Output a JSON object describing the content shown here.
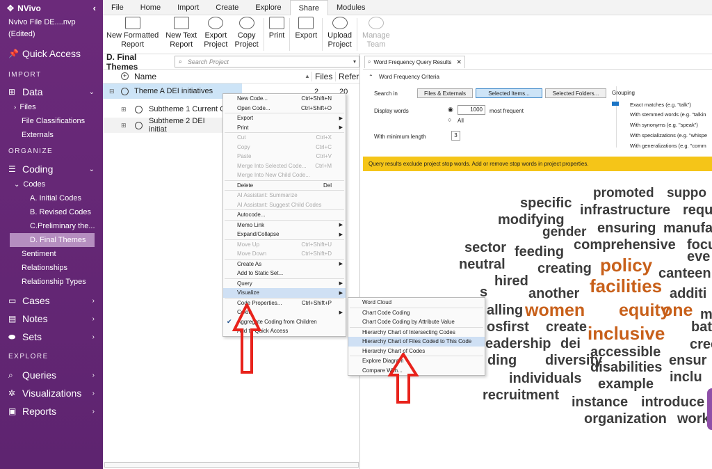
{
  "sidebar": {
    "app_name": "NVivo",
    "collapse": "‹",
    "file_name": "Nvivo File DE....nvp",
    "file_status": "(Edited)",
    "quick_access": "Quick Access",
    "import_section": "IMPORT",
    "data": "Data",
    "files": "Files",
    "file_classifications": "File Classifications",
    "externals": "Externals",
    "organize_section": "ORGANIZE",
    "coding": "Coding",
    "codes": "Codes",
    "codes_items": [
      "A. Initial Codes",
      "B. Revised Codes",
      "C.Preliminary the...",
      "D. Final Themes"
    ],
    "sentiment": "Sentiment",
    "relationships": "Relationships",
    "relationship_types": "Relationship Types",
    "cases": "Cases",
    "notes": "Notes",
    "sets": "Sets",
    "explore_section": "EXPLORE",
    "queries": "Queries",
    "visualizations": "Visualizations",
    "reports": "Reports"
  },
  "ribbon": {
    "tabs": [
      "File",
      "Home",
      "Import",
      "Create",
      "Explore",
      "Share",
      "Modules"
    ],
    "active_tab": "Share",
    "buttons": [
      {
        "line1": "New Formatted",
        "line2": "Report"
      },
      {
        "line1": "New Text",
        "line2": "Report"
      },
      {
        "line1": "Export",
        "line2": "Project"
      },
      {
        "line1": "Copy",
        "line2": "Project"
      },
      {
        "line1": "Print",
        "line2": ""
      },
      {
        "line1": "Export",
        "line2": ""
      },
      {
        "line1": "Upload",
        "line2": "Project"
      },
      {
        "line1": "Manage",
        "line2": "Team"
      }
    ]
  },
  "left_pane": {
    "title": "D. Final Themes",
    "search_placeholder": "Search Project",
    "col_name": "Name",
    "col_files": "Files",
    "col_refs": "Refer",
    "rows": [
      {
        "name": "Theme A DEI initiatives",
        "files": "2",
        "refs": "20"
      },
      {
        "name": "Subtheme 1 Current  C",
        "files": "",
        "refs": ""
      },
      {
        "name": "Subtheme 2 DEI initiat",
        "files": "",
        "refs": ""
      }
    ]
  },
  "context_menu": {
    "items": [
      {
        "label": "New Code...",
        "shortcut": "Ctrl+Shift+N",
        "disabled": false
      },
      {
        "label": "Open Code...",
        "shortcut": "Ctrl+Shift+O",
        "disabled": false
      },
      {
        "label": "Export",
        "shortcut": "",
        "disabled": false,
        "sub": true
      },
      {
        "label": "Print",
        "shortcut": "",
        "disabled": false,
        "sub": true
      },
      {
        "label": "Cut",
        "shortcut": "Ctrl+X",
        "disabled": true
      },
      {
        "label": "Copy",
        "shortcut": "Ctrl+C",
        "disabled": true
      },
      {
        "label": "Paste",
        "shortcut": "Ctrl+V",
        "disabled": true
      },
      {
        "label": "Merge Into Selected Code...",
        "shortcut": "Ctrl+M",
        "disabled": true
      },
      {
        "label": "Merge Into New Child Code...",
        "shortcut": "",
        "disabled": true
      },
      {
        "label": "Delete",
        "shortcut": "Del",
        "disabled": false
      },
      {
        "label": "AI Assistant: Summarize",
        "shortcut": "",
        "disabled": true
      },
      {
        "label": "AI Assistant: Suggest Child Codes",
        "shortcut": "",
        "disabled": true
      },
      {
        "label": "Autocode...",
        "shortcut": "",
        "disabled": false
      },
      {
        "label": "Memo Link",
        "shortcut": "",
        "disabled": false,
        "sub": true
      },
      {
        "label": "Expand/Collapse",
        "shortcut": "",
        "disabled": false,
        "sub": true
      },
      {
        "label": "Move Up",
        "shortcut": "Ctrl+Shift+U",
        "disabled": true
      },
      {
        "label": "Move Down",
        "shortcut": "Ctrl+Shift+D",
        "disabled": true
      },
      {
        "label": "Create As",
        "shortcut": "",
        "disabled": false,
        "sub": true
      },
      {
        "label": "Add to Static Set...",
        "shortcut": "",
        "disabled": false
      },
      {
        "label": "Query",
        "shortcut": "",
        "disabled": false,
        "sub": true
      },
      {
        "label": "Visualize",
        "shortcut": "",
        "disabled": false,
        "sub": true
      },
      {
        "label": "Code Properties...",
        "shortcut": "Ctrl+Shift+P",
        "disabled": false
      },
      {
        "label": "Color",
        "shortcut": "",
        "disabled": false,
        "sub": true
      },
      {
        "label": "Aggregate Coding from Children",
        "shortcut": "",
        "disabled": false
      },
      {
        "label": "Add to Quick Access",
        "shortcut": "",
        "disabled": false
      }
    ]
  },
  "visualize_menu": {
    "items": [
      "Word Cloud",
      "Chart Code Coding",
      "Chart Code Coding by Attribute Value",
      "Hierarchy Chart of Intersecting Codes",
      "Hierarchy Chart of Files Coded to This Code",
      "Hierarchy Chart of Codes",
      "Explore Diagram",
      "Compare With..."
    ]
  },
  "right_pane": {
    "tab_title": "Word Frequency Query Results",
    "criteria_title": "Word Frequency Criteria",
    "search_in": "Search in",
    "btn_files": "Files & Externals",
    "btn_selected_items": "Selected Items...",
    "btn_selected_folders": "Selected Folders...",
    "display_words": "Display words",
    "display_count": "1000",
    "most_frequent": "most frequent",
    "all": "All",
    "min_length": "With minimum length",
    "min_length_value": "3",
    "grouping": "Grouping",
    "grouping_options": [
      "Exact matches (e.g. \"talk\")",
      "With stemmed words (e.g. \"talkin",
      "With synonyms (e.g. \"speak\")",
      "With specializations (e.g. \"whispe",
      "With generalizations (e.g. \"comm"
    ],
    "banner": "Query results exclude project stop words. Add or remove stop words in project properties."
  },
  "word_cloud": {
    "words": [
      {
        "text": "promoted",
        "size": 19,
        "hot": false
      },
      {
        "text": "suppo",
        "size": 19,
        "hot": false
      },
      {
        "text": "specific",
        "size": 20,
        "hot": false
      },
      {
        "text": "infrastructure",
        "size": 20,
        "hot": false
      },
      {
        "text": "requ",
        "size": 20,
        "hot": false
      },
      {
        "text": "modifying",
        "size": 20,
        "hot": false
      },
      {
        "text": "gender",
        "size": 19,
        "hot": false
      },
      {
        "text": "ensuring",
        "size": 20,
        "hot": false
      },
      {
        "text": "manufa",
        "size": 20,
        "hot": false
      },
      {
        "text": "sector",
        "size": 20,
        "hot": false
      },
      {
        "text": "comprehensive",
        "size": 20,
        "hot": false
      },
      {
        "text": "focu",
        "size": 20,
        "hot": false
      },
      {
        "text": "feeding",
        "size": 20,
        "hot": false
      },
      {
        "text": "eve",
        "size": 20,
        "hot": false
      },
      {
        "text": "neutral",
        "size": 20,
        "hot": false
      },
      {
        "text": "creating",
        "size": 20,
        "hot": false
      },
      {
        "text": "policy",
        "size": 26,
        "hot": true
      },
      {
        "text": "canteen",
        "size": 20,
        "hot": false
      },
      {
        "text": "hired",
        "size": 20,
        "hot": false
      },
      {
        "text": "facilities",
        "size": 26,
        "hot": true
      },
      {
        "text": "s",
        "size": 20,
        "hot": false
      },
      {
        "text": "another",
        "size": 20,
        "hot": false
      },
      {
        "text": "additi",
        "size": 20,
        "hot": false
      },
      {
        "text": "alling",
        "size": 20,
        "hot": false
      },
      {
        "text": "women",
        "size": 25,
        "hot": true
      },
      {
        "text": "equity",
        "size": 25,
        "hot": true
      },
      {
        "text": "one",
        "size": 25,
        "hot": true
      },
      {
        "text": "m",
        "size": 20,
        "hot": false
      },
      {
        "text": "os",
        "size": 20,
        "hot": false
      },
      {
        "text": "first",
        "size": 20,
        "hot": false
      },
      {
        "text": "create",
        "size": 20,
        "hot": false
      },
      {
        "text": "inclusive",
        "size": 26,
        "hot": true
      },
      {
        "text": "bathro",
        "size": 20,
        "hot": false
      },
      {
        "text": "eadership",
        "size": 20,
        "hot": false
      },
      {
        "text": "dei",
        "size": 20,
        "hot": false
      },
      {
        "text": "accessible",
        "size": 20,
        "hot": false
      },
      {
        "text": "crech",
        "size": 20,
        "hot": false
      },
      {
        "text": "ding",
        "size": 20,
        "hot": false
      },
      {
        "text": "diversity",
        "size": 20,
        "hot": false
      },
      {
        "text": "disabilities",
        "size": 20,
        "hot": false
      },
      {
        "text": "ensur",
        "size": 20,
        "hot": false
      },
      {
        "text": "individuals",
        "size": 20,
        "hot": false
      },
      {
        "text": "example",
        "size": 20,
        "hot": false
      },
      {
        "text": "inclu",
        "size": 20,
        "hot": false
      },
      {
        "text": "recruitment",
        "size": 20,
        "hot": false
      },
      {
        "text": "instance",
        "size": 20,
        "hot": false
      },
      {
        "text": "introduce",
        "size": 20,
        "hot": false
      },
      {
        "text": "organization",
        "size": 20,
        "hot": false
      },
      {
        "text": "work",
        "size": 20,
        "hot": false
      }
    ]
  },
  "colors": {
    "sidebar": "#6b2a7a",
    "accent_orange": "#c8601a",
    "banner": "#f5c518",
    "arrow": "#e8221b",
    "selection": "#cde4f7"
  }
}
